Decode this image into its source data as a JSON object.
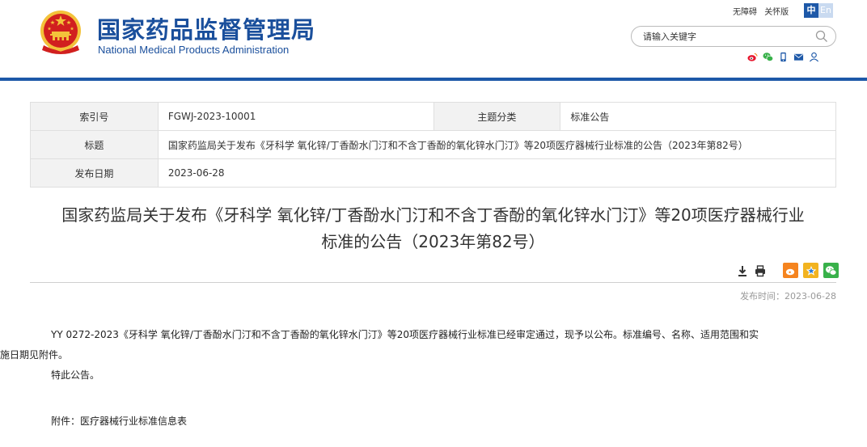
{
  "header": {
    "title_cn": "国家药品监督管理局",
    "title_en": "National Medical Products Administration",
    "accessibility_label": "无障碍",
    "care_mode_label": "关怀版",
    "lang_cn": "中",
    "lang_en": "En",
    "search_placeholder": "请输入关键字",
    "social_icons": [
      "weibo-icon",
      "wechat-icon",
      "mobile-icon",
      "mail-icon",
      "user-icon"
    ]
  },
  "meta": {
    "index_label": "索引号",
    "index_value": "FGWJ-2023-10001",
    "category_label": "主题分类",
    "category_value": "标准公告",
    "title_label": "标题",
    "title_value": "国家药监局关于发布《牙科学 氧化锌/丁香酚水门汀和不含丁香酚的氧化锌水门汀》等20项医疗器械行业标准的公告（2023年第82号）",
    "date_label": "发布日期",
    "date_value": "2023-06-28"
  },
  "article": {
    "title_line1": "国家药监局关于发布《牙科学 氧化锌/丁香酚水门汀和不含丁香酚的氧化锌水门汀》等20项医疗器械行业",
    "title_line2": "标准的公告（2023年第82号）",
    "publish_time": "发布时间：2023-06-28",
    "para1_line1": "YY 0272-2023《牙科学 氧化锌/丁香酚水门汀和不含丁香酚的氧化锌水门汀》等20项医疗器械行业标准已经审定通过，现予以公布。标准编号、名称、适用范围和实",
    "para1_line2": "施日期见附件。",
    "para2": "特此公告。",
    "attachment": "附件：医疗器械行业标准信息表",
    "tools": [
      "download-icon",
      "print-icon",
      "weibo-share-icon",
      "qzone-share-icon",
      "wechat-share-icon"
    ]
  },
  "colors": {
    "brand_blue": "#1a4f9c",
    "rule_blue": "#1d58a8",
    "emblem_red": "#d1201f",
    "emblem_gold": "#f3c23a",
    "weibo_orange": "#f5841f",
    "qzone_yellow": "#f2b320",
    "wechat_green": "#38b14a"
  }
}
